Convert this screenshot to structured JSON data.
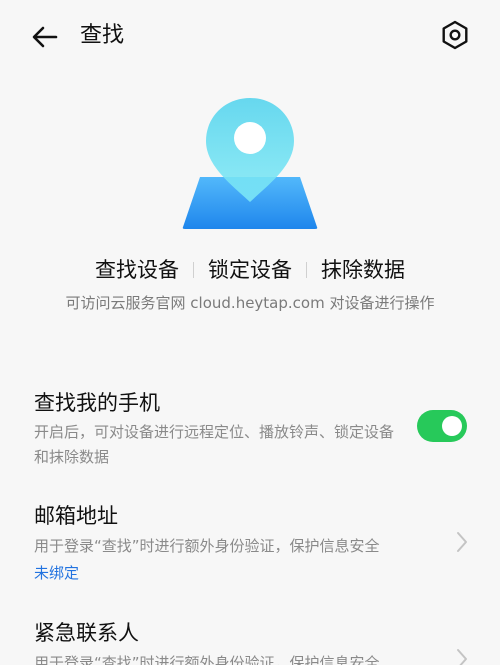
{
  "header": {
    "title": "查找",
    "back_icon": "arrow-left-icon",
    "settings_icon": "settings-hexagon-icon"
  },
  "hero": {
    "icon": "location-pin-map-icon",
    "colors": {
      "pin": "#5fd6ee",
      "map": "#2f8ff0"
    }
  },
  "actions": [
    {
      "label": "查找设备"
    },
    {
      "label": "锁定设备"
    },
    {
      "label": "抹除数据"
    }
  ],
  "subtitle": "可访问云服务官网 cloud.heytap.com 对设备进行操作",
  "settings": {
    "find_phone": {
      "title": "查找我的手机",
      "description": "开启后，可对设备进行远程定位、播放铃声、锁定设备和抹除数据",
      "toggle_on": true,
      "toggle_color": "#27c95a"
    },
    "email": {
      "title": "邮箱地址",
      "description": "用于登录“查找”时进行额外身份验证，保护信息安全",
      "status": "未绑定",
      "status_color": "#2273e0"
    },
    "emergency_contact": {
      "title": "紧急联系人",
      "description": "用于登录“查找”时进行额外身份验证，保护信息安全"
    }
  }
}
